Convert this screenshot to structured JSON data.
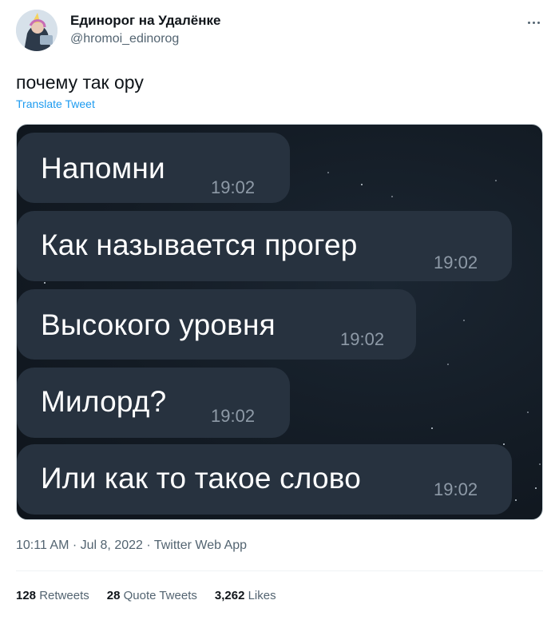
{
  "author": {
    "name": "Единорог на Удалёнке",
    "handle": "@hromoi_edinorog",
    "avatar_icon": "unicorn-avatar-icon"
  },
  "tweet": {
    "text": "почему так ору",
    "translate_label": "Translate Tweet",
    "meta": "10:11 AM · Jul 8, 2022 · Twitter Web App"
  },
  "chat": {
    "messages": [
      {
        "text": "Напомни",
        "time": "19:02"
      },
      {
        "text": "Как называется прогер",
        "time": "19:02"
      },
      {
        "text": "Высокого уровня",
        "time": "19:02"
      },
      {
        "text": "Милорд?",
        "time": "19:02"
      },
      {
        "text": "Или как то такое слово",
        "time": "19:02"
      }
    ]
  },
  "stats": {
    "retweets_count": "128",
    "retweets_label": "Retweets",
    "quotes_count": "28",
    "quotes_label": "Quote Tweets",
    "likes_count": "3,262",
    "likes_label": "Likes"
  },
  "colors": {
    "accent": "#1d9bf0",
    "bubble": "#27323f",
    "chat_background": "#131b24"
  },
  "icons": [
    "more-options-icon"
  ]
}
